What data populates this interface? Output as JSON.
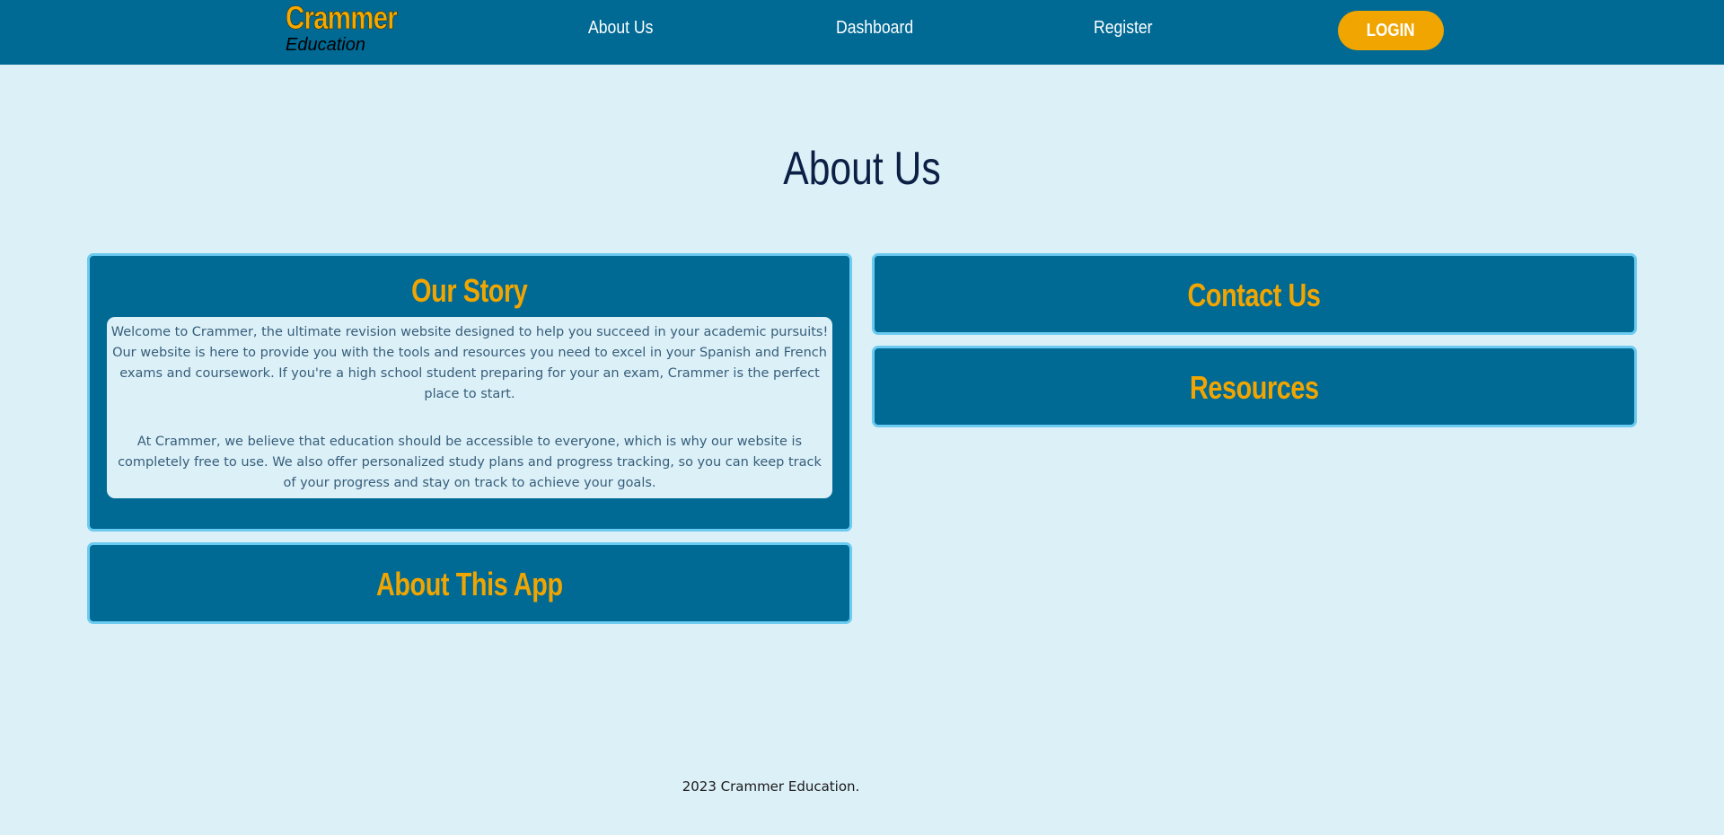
{
  "brand": {
    "title": "Crammer",
    "subtitle": "Education"
  },
  "nav": {
    "about": "About Us",
    "dashboard": "Dashboard",
    "register": "Register",
    "login": "LOGIN"
  },
  "page": {
    "title": "About Us"
  },
  "cards": {
    "story": {
      "heading": "Our Story",
      "paragraphs": [
        "Welcome to Crammer, the ultimate revision website designed to help you succeed in your academic pursuits! Our website is here to provide you with the tools and resources you need to excel in your Spanish and French exams and coursework. If you're a high school student preparing for your an exam, Crammer is the perfect place to start.",
        "At Crammer, we believe that education should be accessible to everyone, which is why our website is completely free to use. We also offer personalized study plans and progress tracking, so you can keep track of your progress and stay on track to achieve your goals."
      ]
    },
    "app": {
      "heading": "About This App"
    },
    "contact": {
      "heading": "Contact Us"
    },
    "resources": {
      "heading": "Resources"
    }
  },
  "footer": {
    "text": "2023 Crammer Education."
  },
  "colors": {
    "navbar": "#006994",
    "background": "#dcf0f8",
    "accent": "#f0a500",
    "card_border": "#6ccbf0",
    "title": "#0c1f45"
  }
}
